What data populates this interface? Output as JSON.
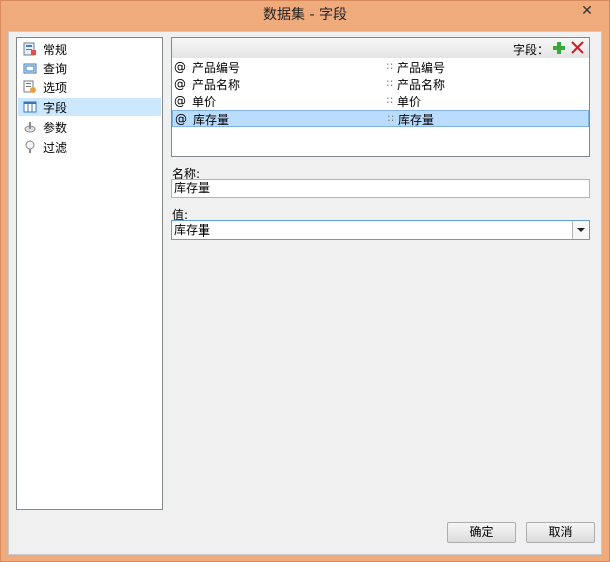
{
  "window": {
    "title": "数据集 - 字段",
    "close_glyph": "✕"
  },
  "nav": {
    "items": [
      {
        "label": "常规",
        "icon": "general-icon"
      },
      {
        "label": "查询",
        "icon": "query-icon"
      },
      {
        "label": "选项",
        "icon": "options-icon"
      },
      {
        "label": "字段",
        "icon": "fields-icon",
        "selected": true
      },
      {
        "label": "参数",
        "icon": "parameters-icon"
      },
      {
        "label": "过滤",
        "icon": "filter-icon"
      }
    ]
  },
  "fields": {
    "header_label": "字段：",
    "rows": [
      {
        "prefix": "@",
        "name": "产品编号",
        "sep": "::",
        "value": "产品编号"
      },
      {
        "prefix": "@",
        "name": "产品名称",
        "sep": "::",
        "value": "产品名称"
      },
      {
        "prefix": "@",
        "name": "单价",
        "sep": "::",
        "value": "单价"
      },
      {
        "prefix": "@",
        "name": "库存量",
        "sep": "::",
        "value": "库存量",
        "selected": true
      }
    ]
  },
  "form": {
    "name_label": "名称:",
    "name_value": "库存量",
    "value_label": "值:",
    "value_value": "库存量"
  },
  "buttons": {
    "ok": "确定",
    "cancel": "取消"
  },
  "colors": {
    "titlebar": "#f0ab7d",
    "selection": "#cce8ff",
    "add": "#3aa83a",
    "delete": "#d21f1f"
  }
}
